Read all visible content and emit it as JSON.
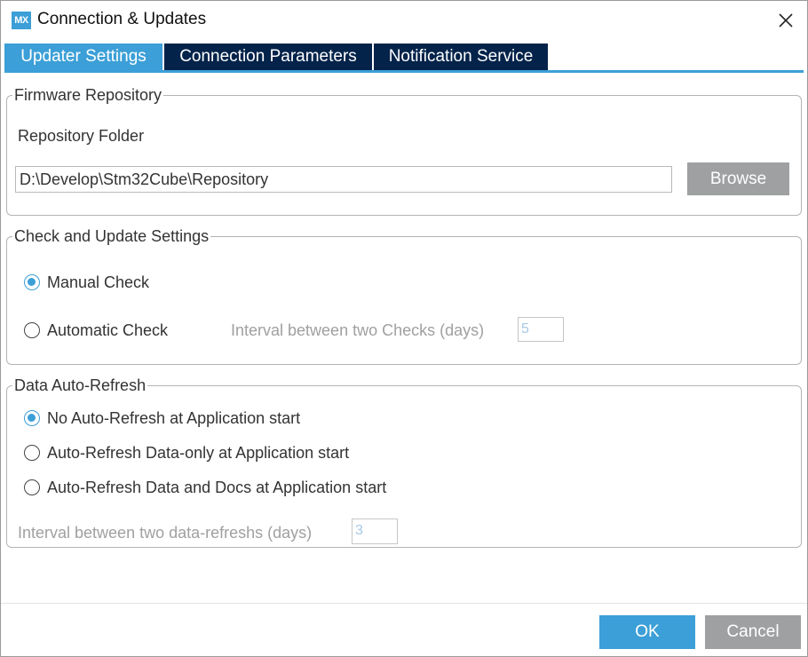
{
  "window": {
    "title": "Connection & Updates",
    "logo_text": "MX",
    "accent_color": "#3c9fd7",
    "tab_dark_color": "#04234a"
  },
  "tabs": [
    {
      "label": "Updater Settings",
      "active": true
    },
    {
      "label": "Connection Parameters",
      "active": false
    },
    {
      "label": "Notification Service",
      "active": false
    }
  ],
  "firmware": {
    "legend": "Firmware Repository",
    "folder_label": "Repository Folder",
    "folder_value": "D:\\Develop\\Stm32Cube\\Repository",
    "browse_label": "Browse"
  },
  "check_update": {
    "legend": "Check and Update Settings",
    "manual_label": "Manual Check",
    "manual_checked": true,
    "auto_label": "Automatic Check",
    "auto_checked": false,
    "interval_label": "Interval between two Checks (days)",
    "interval_value": "5"
  },
  "auto_refresh": {
    "legend": "Data Auto-Refresh",
    "options": [
      {
        "label": "No Auto-Refresh at Application start",
        "checked": true
      },
      {
        "label": "Auto-Refresh Data-only at Application start",
        "checked": false
      },
      {
        "label": "Auto-Refresh Data and Docs at Application start",
        "checked": false
      }
    ],
    "interval_label": "Interval between two data-refreshs (days)",
    "interval_value": "3"
  },
  "footer": {
    "ok_label": "OK",
    "cancel_label": "Cancel"
  }
}
